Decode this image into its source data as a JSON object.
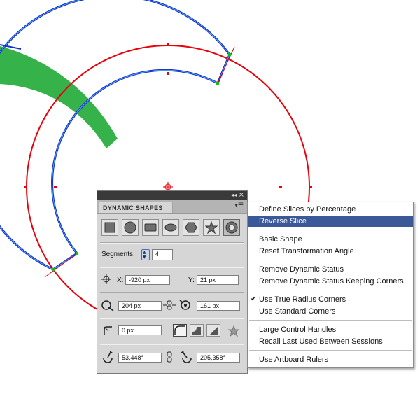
{
  "canvas": {
    "colors": {
      "outer_circle": "#e8000b",
      "shape_outline": "#1630c8",
      "selection_edge": "#12c010",
      "green_shape": "#35b34a"
    }
  },
  "panel": {
    "title": "DYNAMIC SHAPES",
    "shapes": [
      "rectangle-icon",
      "circle-icon",
      "rounded-rect-icon",
      "ellipse-icon",
      "hexagon-icon",
      "star-icon",
      "donut-icon"
    ],
    "segments_label": "Segments:",
    "segments_value": "4",
    "x_label": "X:",
    "x_value": "-920 px",
    "y_label": "Y:",
    "y_value": "21 px",
    "outer_radius": "204 px",
    "inner_radius": "161 px",
    "corner_radius": "0 px",
    "start_angle": "53,448°",
    "end_angle": "205,358°"
  },
  "menu": {
    "items": [
      "Define Slices by Percentage",
      "Reverse Slice",
      "Basic Shape",
      "Reset Transformation Angle",
      "Remove Dynamic Status",
      "Remove Dynamic Status Keeping Corners",
      "Use True Radius Corners",
      "Use Standard Corners",
      "Large Control Handles",
      "Recall Last Used Between Sessions",
      "Use Artboard Rulers"
    ],
    "highlight_color": "#3b5998"
  }
}
